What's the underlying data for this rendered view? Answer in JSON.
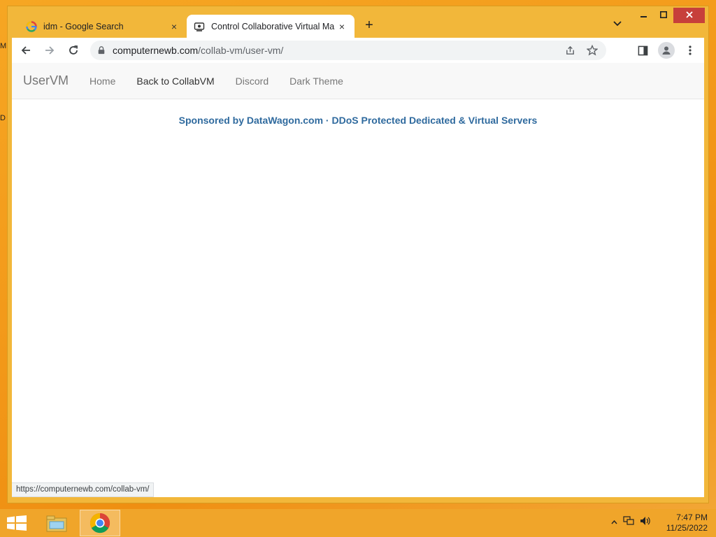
{
  "desktop": {
    "edge_labels": [
      "M",
      "D"
    ]
  },
  "browser": {
    "tabs": [
      {
        "title": "idm - Google Search",
        "icon": "google-icon",
        "active": false
      },
      {
        "title": "Control Collaborative Virtual Ma",
        "icon": "collabvm-icon",
        "active": true
      }
    ],
    "new_tab": "+",
    "close_tab": "×",
    "address": {
      "host": "computernewb.com",
      "path": "/collab-vm/user-vm/"
    },
    "status_url": "https://computernewb.com/collab-vm/"
  },
  "page": {
    "brand": "UserVM",
    "nav": [
      "Home",
      "Back to CollabVM",
      "Discord",
      "Dark Theme"
    ],
    "sponsor": "Sponsored by DataWagon.com · DDoS Protected Dedicated & Virtual Servers"
  },
  "taskbar": {
    "time": "7:47 PM",
    "date": "11/25/2022"
  },
  "colors": {
    "accent": "#f6a623",
    "close_button": "#c7403a",
    "sponsor_link": "#2f6a9e"
  }
}
